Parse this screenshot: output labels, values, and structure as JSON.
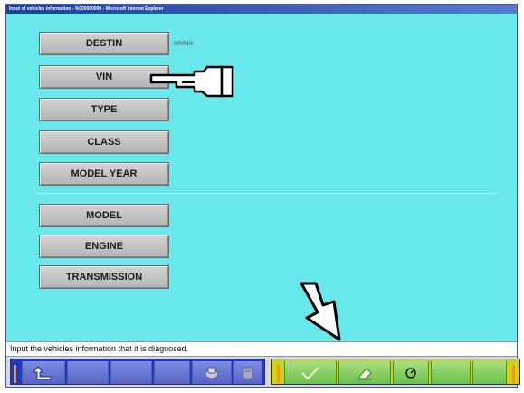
{
  "window": {
    "title": "Input of vehicles information - %000000000 - Microsoft Internet Explorer"
  },
  "fields": [
    {
      "label": "DESTIN",
      "value": "MMNA"
    },
    {
      "label": "VIN",
      "value": ""
    },
    {
      "label": "TYPE",
      "value": ""
    },
    {
      "label": "CLASS",
      "value": ""
    },
    {
      "label": "MODEL YEAR",
      "value": ""
    },
    {
      "label": "MODEL",
      "value": ""
    },
    {
      "label": "ENGINE",
      "value": ""
    },
    {
      "label": "TRANSMISSION",
      "value": ""
    }
  ],
  "status": {
    "message": "Input the vehicles information that it is diagnosed."
  },
  "toolbar": {
    "left_icons": [
      "up-arrow-icon",
      "",
      "",
      "",
      "gear-icon",
      "print-icon"
    ],
    "right_icons": [
      "check-icon",
      "eraser-icon",
      "refresh-icon",
      "",
      ""
    ]
  },
  "colors": {
    "background": "#68e8ea",
    "button_gray": "#c4c4c4",
    "toolbar_blue": "#2436c8",
    "toolbar_green": "#6cc04a",
    "accent_orange": "#f29a0e"
  }
}
